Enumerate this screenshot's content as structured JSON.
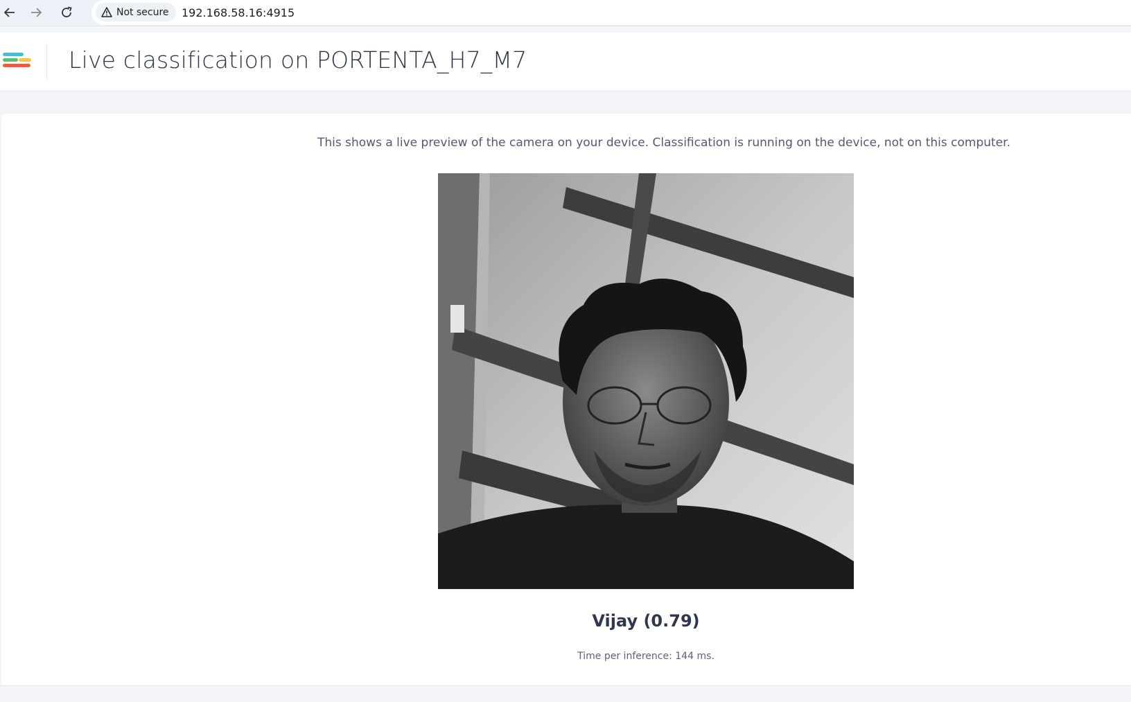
{
  "browser": {
    "security_label": "Not secure",
    "url": "192.168.58.16:4915",
    "icons": [
      "back-arrow-icon",
      "forward-arrow-icon",
      "reload-icon",
      "warning-triangle-icon"
    ]
  },
  "header": {
    "title": "Live classification on PORTENTA_H7_M7",
    "logo_colors": [
      "#3fc1d3",
      "#f5c842",
      "#5fbf6b",
      "#ef5a3c"
    ]
  },
  "main": {
    "description": "This shows a live preview of the camera on your device. Classification is running on the device, not on this computer.",
    "classification": "Vijay (0.79)",
    "timing": "Time per inference: 144 ms."
  },
  "colors": {
    "accent_title": "#2c3347",
    "background": "#f3f5f9"
  }
}
